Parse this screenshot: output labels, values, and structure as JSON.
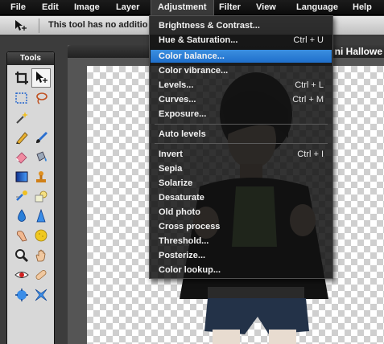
{
  "menubar": {
    "items": [
      {
        "label": "File"
      },
      {
        "label": "Edit"
      },
      {
        "label": "Image"
      },
      {
        "label": "Layer"
      },
      {
        "label": "Adjustment"
      },
      {
        "label": "Filter"
      },
      {
        "label": "View"
      },
      {
        "label": "Language"
      },
      {
        "label": "Help"
      }
    ]
  },
  "options": {
    "message": "This tool has no additio"
  },
  "tools": {
    "title": "Tools",
    "items": [
      "crop-icon",
      "move-icon",
      "marquee-icon",
      "lasso-icon",
      "magic-wand-icon",
      "blank",
      "pencil-icon",
      "brush-icon",
      "eraser-icon",
      "paint-bucket-icon",
      "gradient-icon",
      "clone-stamp-icon",
      "color-replace-icon",
      "shape-icon",
      "blur-icon",
      "sharpen-icon",
      "smudge-icon",
      "sponge-icon",
      "zoom-icon",
      "hand-icon",
      "red-eye-icon",
      "bandage-icon",
      "bloat-icon",
      "pinch-icon"
    ]
  },
  "document": {
    "title": "ni Hallowe"
  },
  "adjustment_menu": {
    "items": [
      {
        "label": "Brightness & Contrast...",
        "shortcut": ""
      },
      {
        "label": "Hue & Saturation...",
        "shortcut": "Ctrl + U"
      },
      {
        "label": "Color balance...",
        "shortcut": "",
        "highlighted": true
      },
      {
        "label": "Color vibrance...",
        "shortcut": ""
      },
      {
        "label": "Levels...",
        "shortcut": "Ctrl + L"
      },
      {
        "label": "Curves...",
        "shortcut": "Ctrl + M"
      },
      {
        "label": "Exposure...",
        "shortcut": ""
      },
      {
        "label": "Auto levels",
        "shortcut": ""
      },
      {
        "label": "Invert",
        "shortcut": "Ctrl + I"
      },
      {
        "label": "Sepia",
        "shortcut": ""
      },
      {
        "label": "Solarize",
        "shortcut": ""
      },
      {
        "label": "Desaturate",
        "shortcut": ""
      },
      {
        "label": "Old photo",
        "shortcut": ""
      },
      {
        "label": "Cross process",
        "shortcut": ""
      },
      {
        "label": "Threshold...",
        "shortcut": ""
      },
      {
        "label": "Posterize...",
        "shortcut": ""
      },
      {
        "label": "Color lookup...",
        "shortcut": ""
      }
    ]
  },
  "colors": {
    "highlight": "#2a7fd8",
    "menubar": "#141414"
  }
}
